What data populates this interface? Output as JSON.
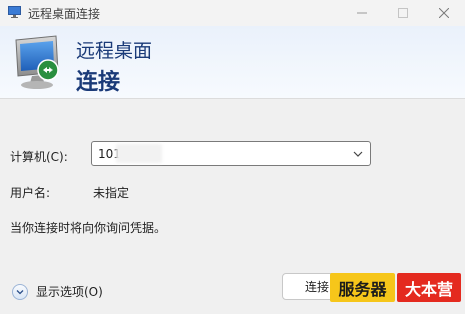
{
  "window": {
    "title": "远程桌面连接"
  },
  "banner": {
    "line1": "远程桌面",
    "line2": "连接"
  },
  "form": {
    "computer_label": "计算机(C):",
    "computer_value": "101 213",
    "username_label": "用户名:",
    "username_value": "未指定",
    "hint": "当你连接时将向你询问凭据。"
  },
  "footer": {
    "options_label": "显示选项(O)",
    "connect_label": "连接("
  },
  "watermark": {
    "part1": "服务器",
    "part2": "大本营"
  },
  "colors": {
    "banner_text": "#1a3a78",
    "watermark_yellow": "#f6c61a",
    "watermark_red": "#e42a1f"
  }
}
